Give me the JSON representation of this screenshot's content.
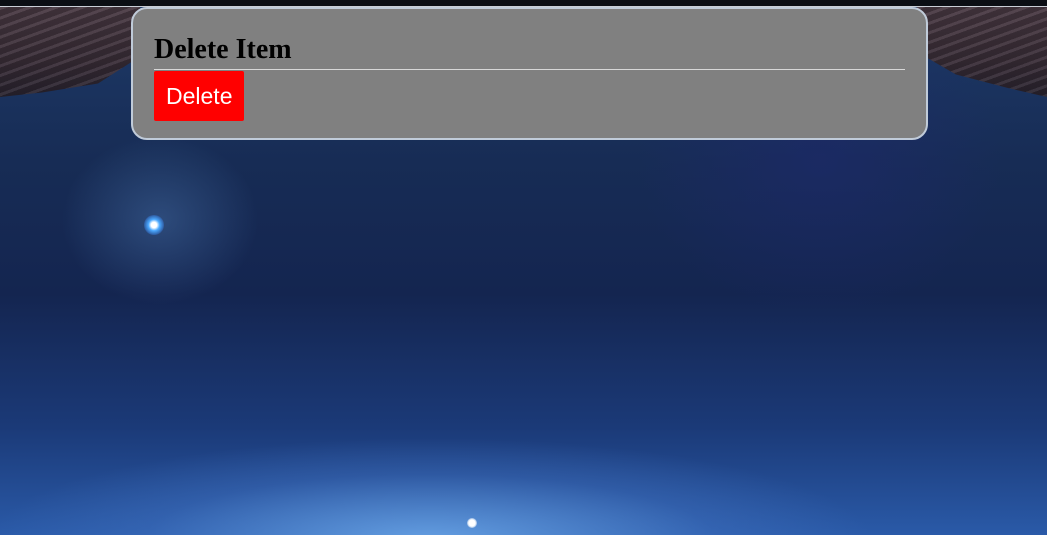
{
  "dialog": {
    "title": "Delete Item",
    "delete_label": "Delete"
  },
  "colors": {
    "panel_background": "#808080",
    "panel_border": "#c0cbd9",
    "delete_button": "#ff0000",
    "delete_button_text": "#ffffff"
  },
  "background": {
    "scene": "space-starship-backdrop"
  }
}
